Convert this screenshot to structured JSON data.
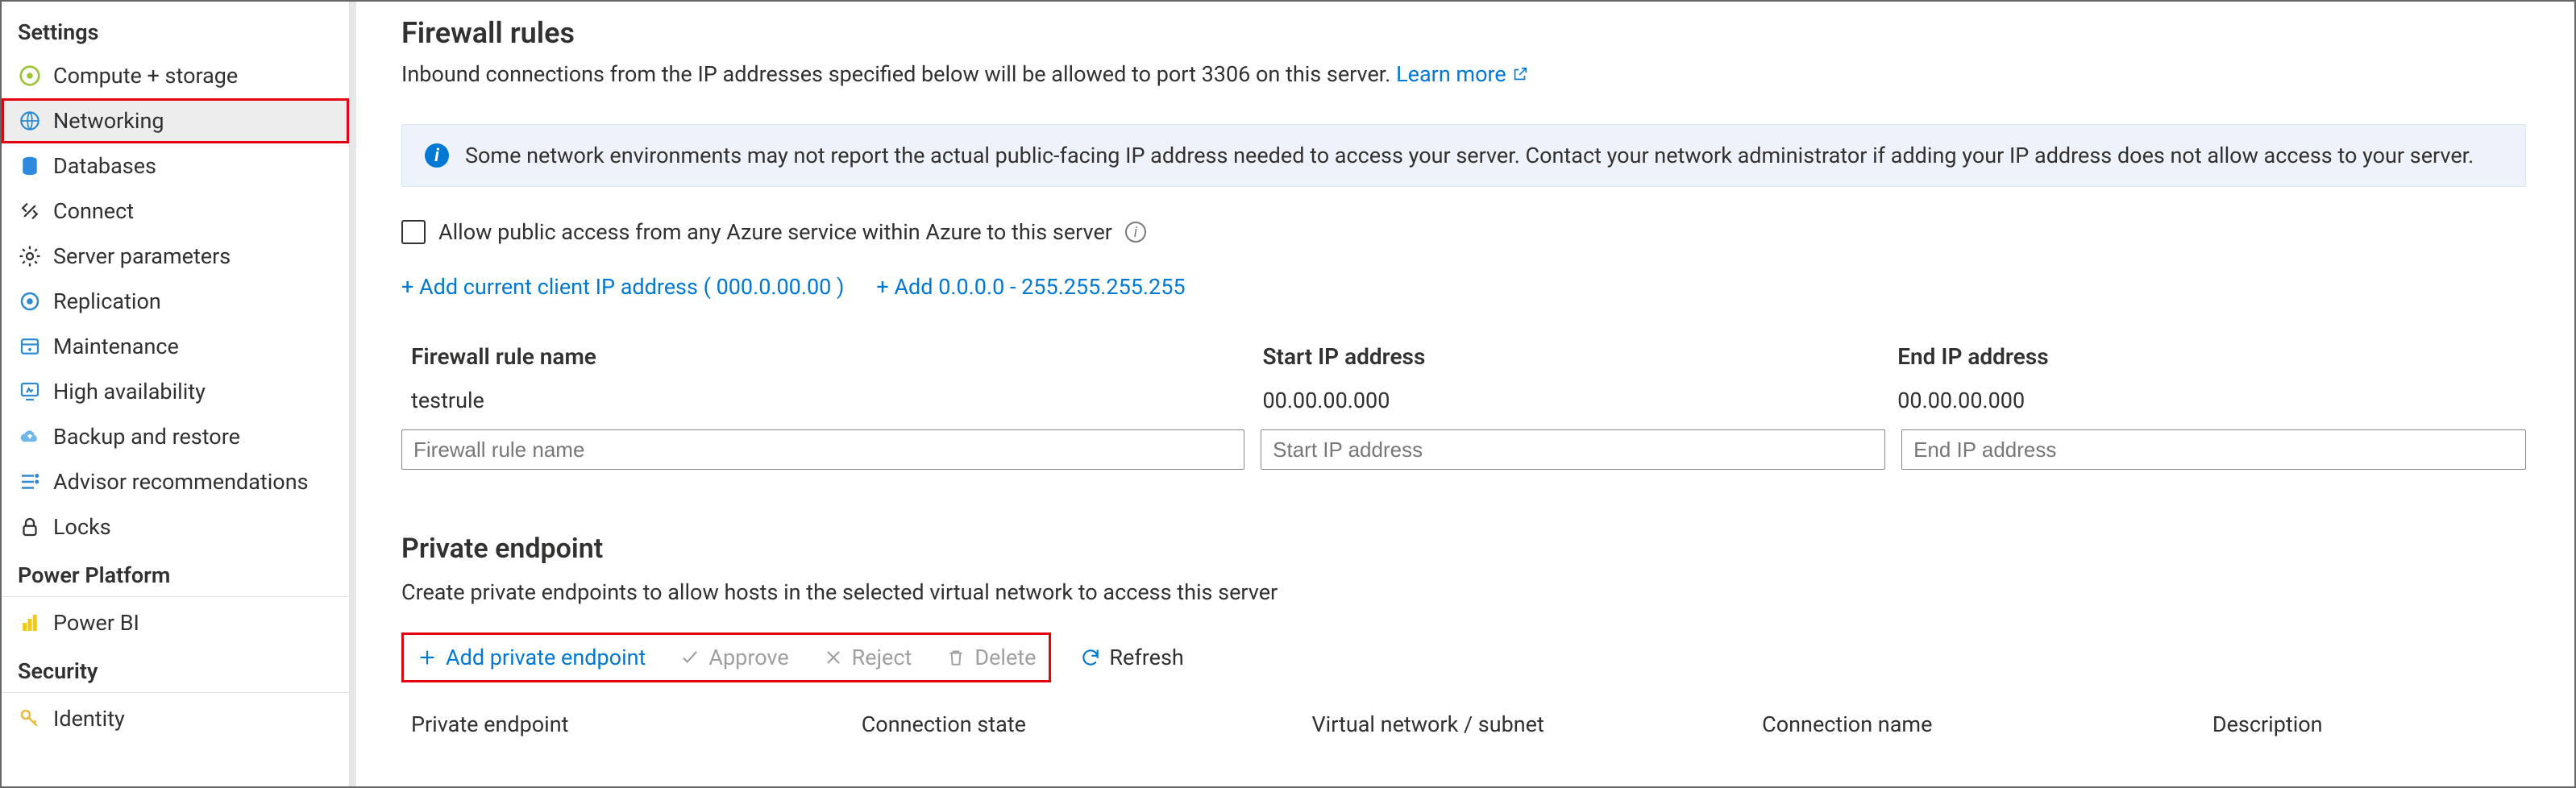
{
  "sidebar": {
    "sections": {
      "settings_label": "Settings",
      "power_platform_label": "Power Platform",
      "security_label": "Security"
    },
    "items": {
      "compute": "Compute + storage",
      "networking": "Networking",
      "databases": "Databases",
      "connect": "Connect",
      "server_params": "Server parameters",
      "replication": "Replication",
      "maintenance": "Maintenance",
      "ha": "High availability",
      "backup": "Backup and restore",
      "advisor": "Advisor recommendations",
      "locks": "Locks",
      "powerbi": "Power BI",
      "identity": "Identity"
    }
  },
  "main": {
    "firewall": {
      "title": "Firewall rules",
      "desc_prefix": "Inbound connections from the IP addresses specified below will be allowed to port 3306 on this server. ",
      "learn_more": "Learn more",
      "info_text": "Some network environments may not report the actual public-facing IP address needed to access your server.  Contact your network administrator if adding your IP address does not allow access to your server.",
      "allow_public_label": "Allow public access from any Azure service within Azure to this server",
      "add_current_ip": "+ Add current client IP address ( 000.0.00.00 )",
      "add_range": "+ Add 0.0.0.0 - 255.255.255.255",
      "cols": {
        "name": "Firewall rule name",
        "start": "Start IP address",
        "end": "End IP address"
      },
      "row1": {
        "name": "testrule",
        "start": "00.00.00.000",
        "end": "00.00.00.000"
      },
      "placeholders": {
        "name": "Firewall rule name",
        "start": "Start IP address",
        "end": "End IP address"
      }
    },
    "pe": {
      "title": "Private endpoint",
      "desc": "Create private endpoints to allow hosts in the selected virtual network to access this server",
      "actions": {
        "add": "Add private endpoint",
        "approve": "Approve",
        "reject": "Reject",
        "delete": "Delete",
        "refresh": "Refresh"
      },
      "cols": {
        "endpoint": "Private endpoint",
        "state": "Connection state",
        "vnet": "Virtual network / subnet",
        "conn": "Connection name",
        "descr": "Description"
      }
    }
  }
}
